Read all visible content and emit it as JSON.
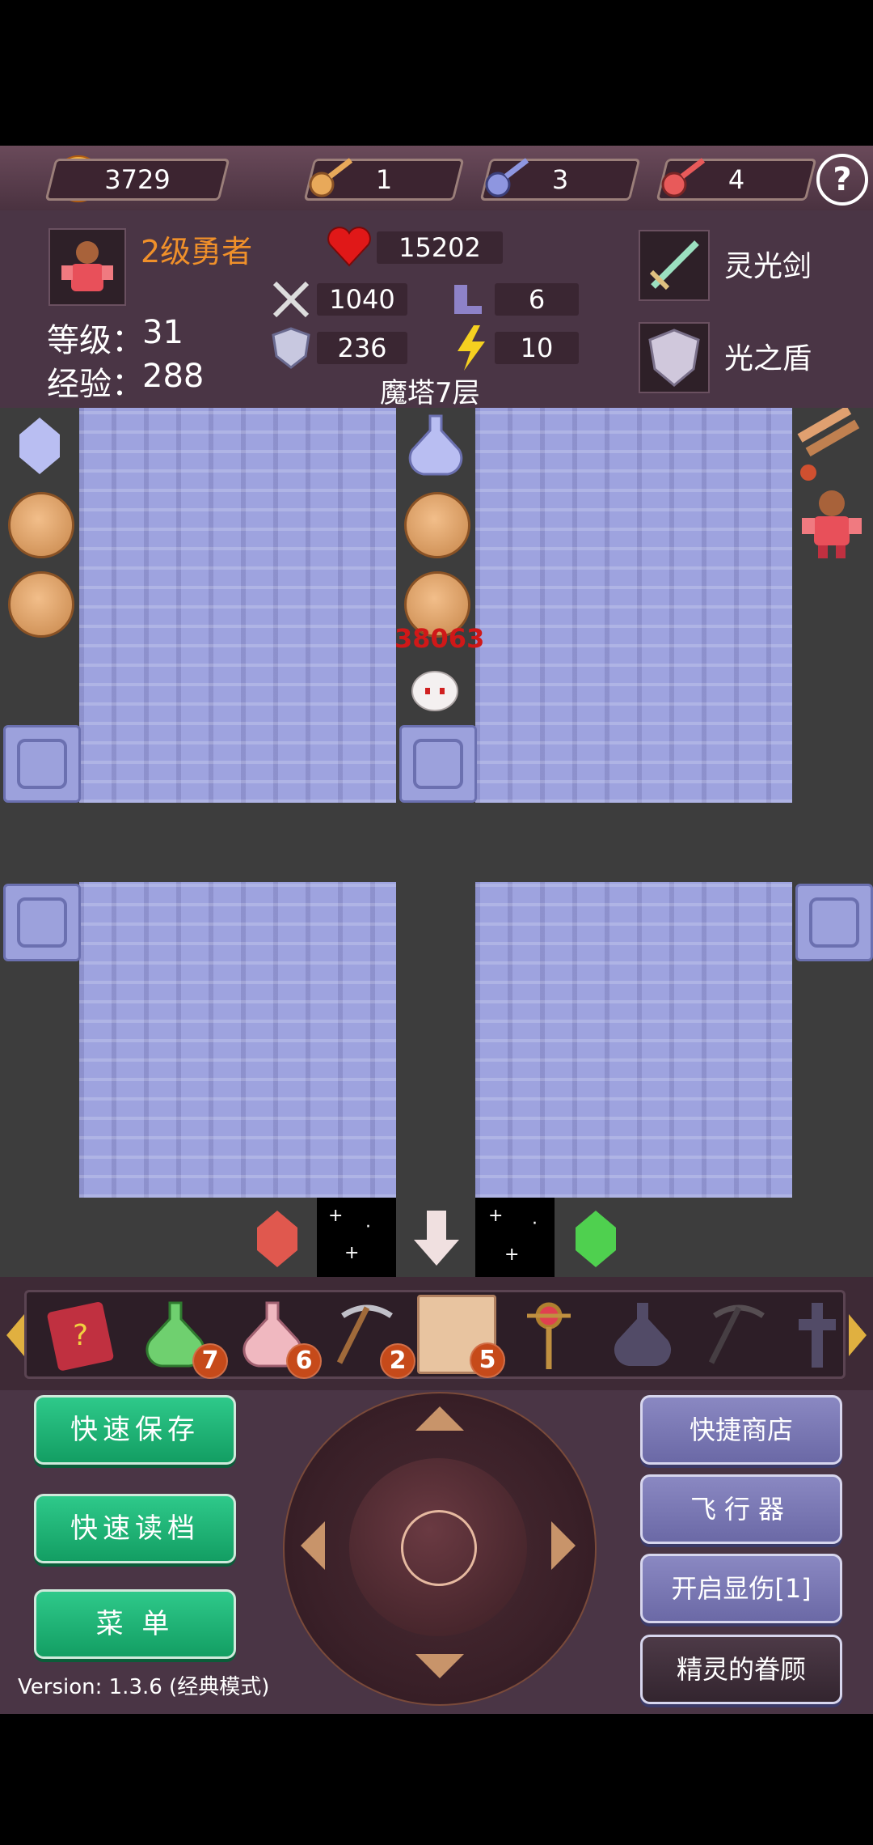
{
  "resources": {
    "gold": "3729",
    "yellow_keys": "1",
    "blue_keys": "3",
    "red_keys": "4",
    "help_label": "?"
  },
  "hero": {
    "title": "2级勇者",
    "level_label": "等级：",
    "level": "31",
    "exp_label": "经验：",
    "exp": "288"
  },
  "stats": {
    "hp": "15202",
    "attack": "1040",
    "speed": "6",
    "defense": "236",
    "magic": "10"
  },
  "equipment": {
    "weapon": "灵光剑",
    "shield": "光之盾"
  },
  "floor": "魔塔7层",
  "map": {
    "damage_text": "38063"
  },
  "items": {
    "green_potion": "7",
    "pink_potion": "6",
    "pickaxe": "2",
    "door_item": "5"
  },
  "buttons": {
    "quick_save": "快速保存",
    "quick_load": "快速读档",
    "menu": "菜 单",
    "quick_shop": "快捷商店",
    "flyer": "飞行器",
    "show_damage": "开启显伤[1]",
    "spirit": "精灵的眷顾"
  },
  "version": "Version: 1.3.6 (经典模式)",
  "colors": {
    "hero_title": "#f0902a",
    "damage_text": "#d01818",
    "green_button": "#1fb474",
    "purple_button": "#7a78b6",
    "wall": "#9ea3df",
    "floor": "#3d3d3d"
  }
}
